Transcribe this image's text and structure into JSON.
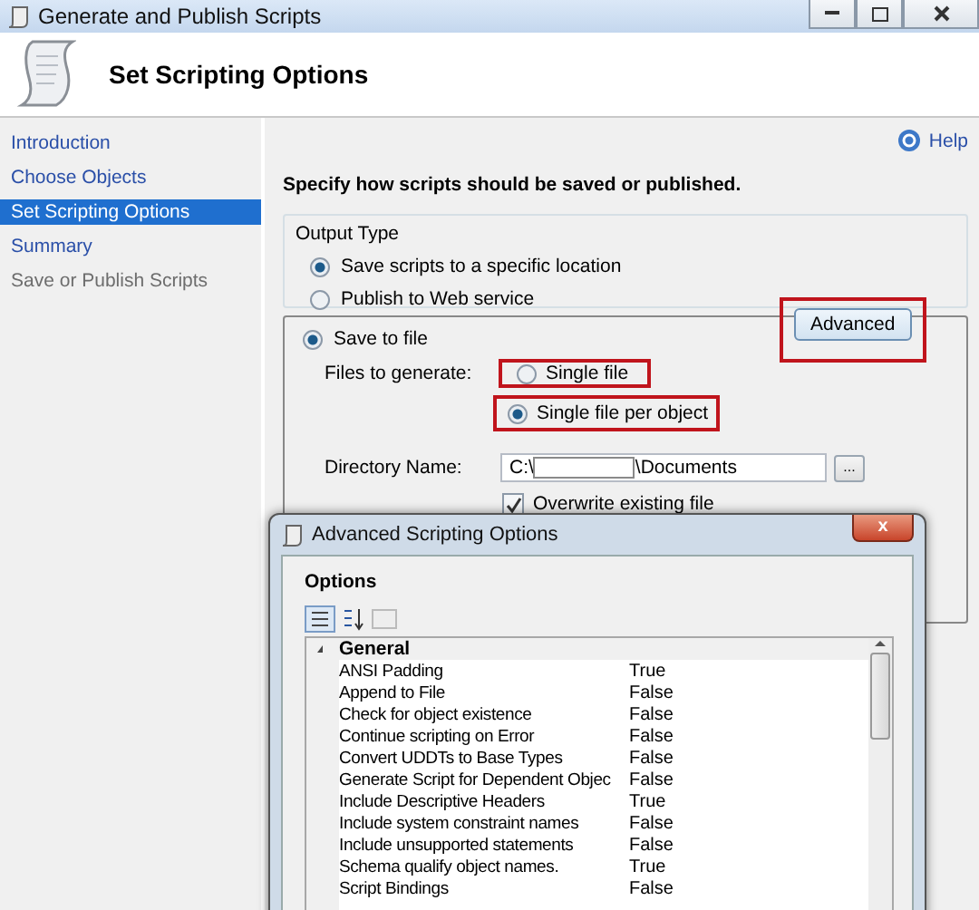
{
  "window": {
    "title": "Generate and Publish Scripts"
  },
  "header": {
    "title": "Set Scripting Options"
  },
  "sidebar": {
    "items": [
      {
        "label": "Introduction",
        "selected": false,
        "disabled": false
      },
      {
        "label": "Choose Objects",
        "selected": false,
        "disabled": false
      },
      {
        "label": "Set Scripting Options",
        "selected": true,
        "disabled": false
      },
      {
        "label": "Summary",
        "selected": false,
        "disabled": false
      },
      {
        "label": "Save or Publish Scripts",
        "selected": false,
        "disabled": true
      }
    ]
  },
  "help": "Help",
  "instruction": "Specify how scripts should be saved or published.",
  "output_type": {
    "label": "Output Type",
    "options": [
      {
        "label": "Save scripts to a specific location",
        "selected": true
      },
      {
        "label": "Publish to Web service",
        "selected": false
      }
    ]
  },
  "save_to_file": {
    "label": "Save to file",
    "selected": true,
    "advanced_button": "Advanced",
    "files_label": "Files to generate:",
    "files_options": [
      {
        "label": "Single file",
        "selected": false
      },
      {
        "label": "Single file per object",
        "selected": true
      }
    ],
    "directory_label": "Directory Name:",
    "directory_prefix": "C:\\",
    "directory_suffix": "\\Documents",
    "browse_button": "...",
    "overwrite": {
      "label": "Overwrite existing file",
      "checked": true
    }
  },
  "dialog": {
    "title": "Advanced Scripting Options",
    "close": "x",
    "section": "Options",
    "category": {
      "label": "General",
      "expanded": true,
      "rows": [
        {
          "name": "ANSI Padding",
          "value": "True"
        },
        {
          "name": "Append to File",
          "value": "False"
        },
        {
          "name": "Check for object existence",
          "value": "False"
        },
        {
          "name": "Continue scripting on Error",
          "value": "False"
        },
        {
          "name": "Convert UDDTs to Base Types",
          "value": "False"
        },
        {
          "name": "Generate Script for Dependent Objec",
          "value": "False"
        },
        {
          "name": "Include Descriptive Headers",
          "value": "True"
        },
        {
          "name": "Include system constraint names",
          "value": "False"
        },
        {
          "name": "Include unsupported statements",
          "value": "False"
        },
        {
          "name": "Schema qualify object names.",
          "value": "True"
        },
        {
          "name": "Script Bindings",
          "value": "False"
        }
      ]
    }
  }
}
